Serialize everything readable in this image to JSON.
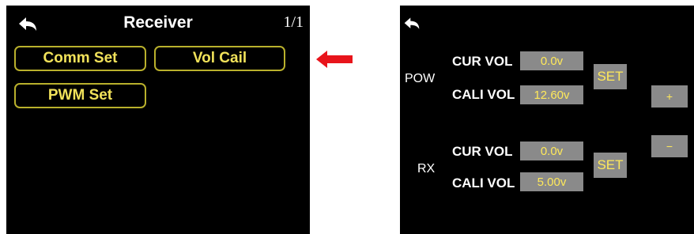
{
  "receiver_screen": {
    "title": "Receiver",
    "page_indicator": "1/1",
    "back_icon": "back-arrow-icon",
    "buttons": [
      {
        "label": "Comm Set"
      },
      {
        "label": "Vol Cail"
      },
      {
        "label": "PWM Set"
      }
    ]
  },
  "pointer": {
    "icon": "left-arrow-icon",
    "color": "#e8141b"
  },
  "vol_cali_screen": {
    "back_icon": "back-arrow-icon",
    "pow": {
      "group_label": "POW",
      "cur_label": "CUR VOL",
      "cur_value": "0.0v",
      "cali_label": "CALI VOL",
      "cali_value": "12.60v",
      "set_label": "SET"
    },
    "rx": {
      "group_label": "RX",
      "cur_label": "CUR VOL",
      "cur_value": "0.0v",
      "cali_label": "CALI VOL",
      "cali_value": "5.00v",
      "set_label": "SET"
    },
    "plus_label": "+",
    "minus_label": "−"
  },
  "colors": {
    "screen_bg": "#000000",
    "button_border": "#b9b02c",
    "button_text": "#f1e25a",
    "value_bg": "#8a8a8a",
    "value_text": "#ffe95a"
  }
}
